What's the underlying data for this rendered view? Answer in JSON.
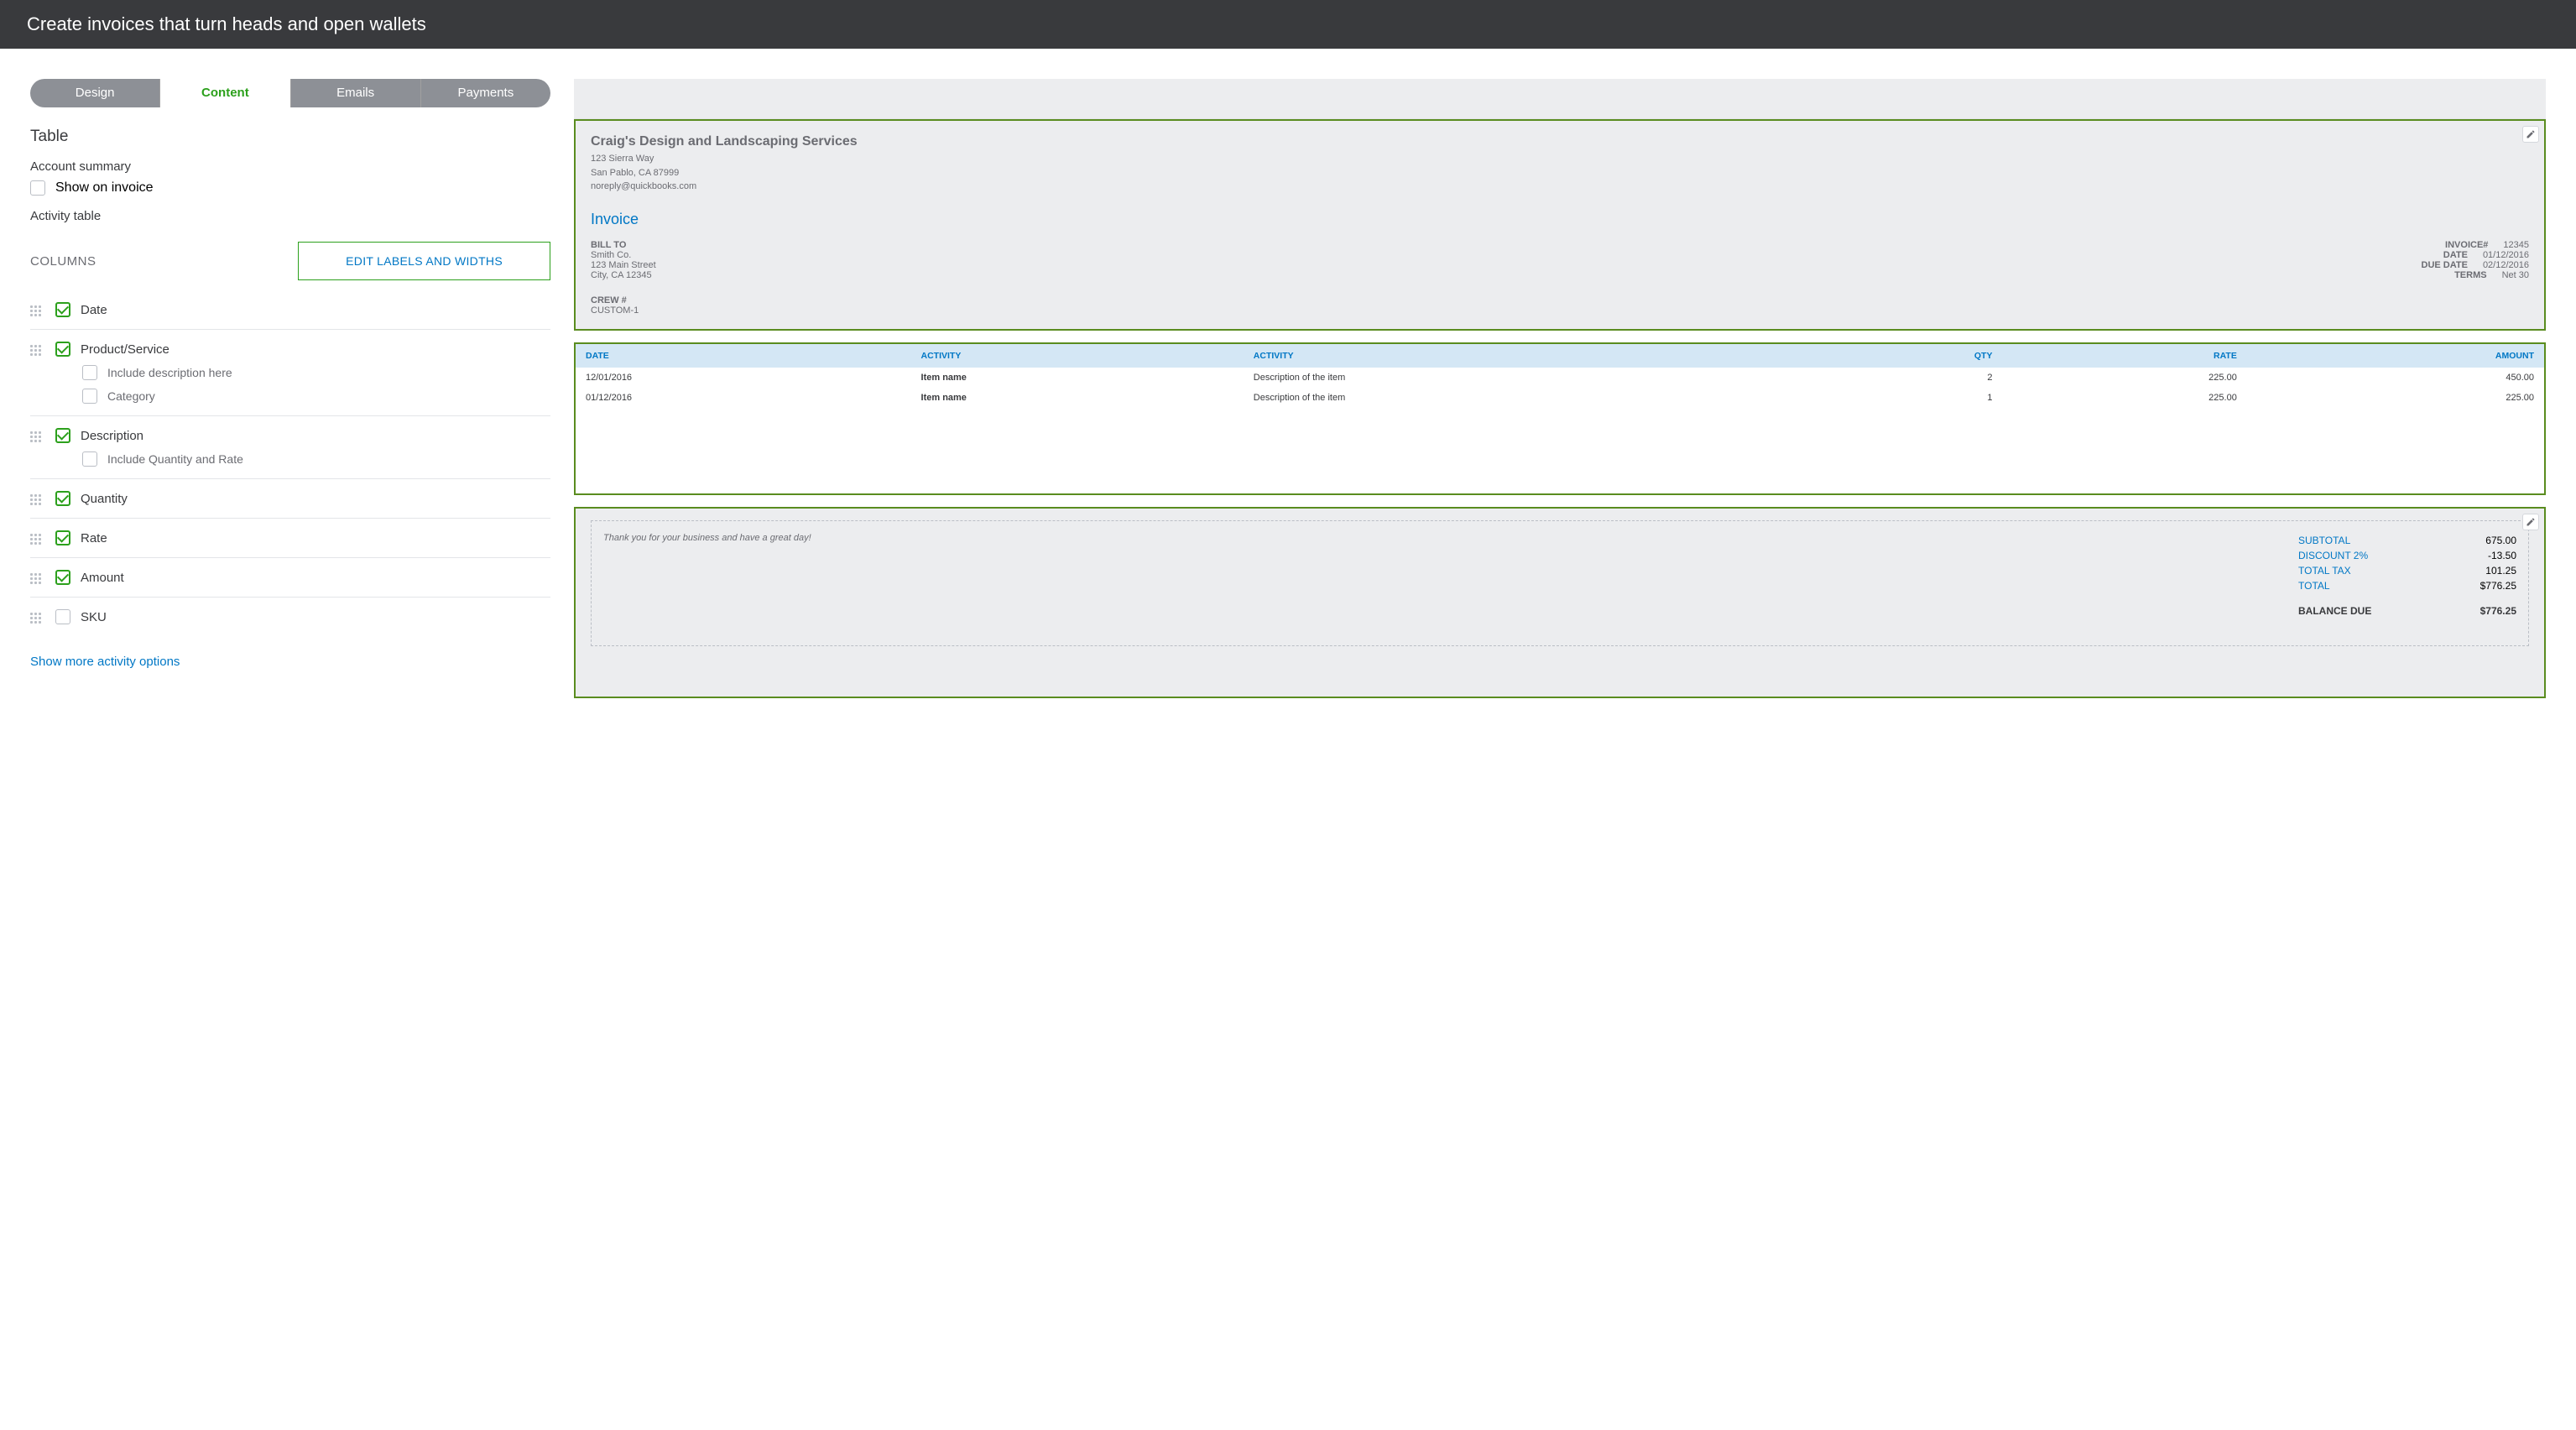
{
  "header": {
    "title": "Create invoices that turn heads and open wallets"
  },
  "tabs": [
    {
      "label": "Design",
      "active": false
    },
    {
      "label": "Content",
      "active": true
    },
    {
      "label": "Emails",
      "active": false
    },
    {
      "label": "Payments",
      "active": false
    }
  ],
  "table_section": {
    "title": "Table",
    "account_summary": "Account summary",
    "show_on_invoice": "Show on invoice",
    "activity_table": "Activity table",
    "columns_label": "COLUMNS",
    "edit_labels_btn": "EDIT LABELS AND WIDTHS",
    "columns": [
      {
        "name": "Date",
        "checked": true,
        "subs": []
      },
      {
        "name": "Product/Service",
        "checked": true,
        "subs": [
          {
            "name": "Include description here",
            "checked": false
          },
          {
            "name": "Category",
            "checked": false
          }
        ]
      },
      {
        "name": "Description",
        "checked": true,
        "subs": [
          {
            "name": "Include Quantity and Rate",
            "checked": false
          }
        ]
      },
      {
        "name": "Quantity",
        "checked": true,
        "subs": []
      },
      {
        "name": "Rate",
        "checked": true,
        "subs": []
      },
      {
        "name": "Amount",
        "checked": true,
        "subs": []
      },
      {
        "name": "SKU",
        "checked": false,
        "subs": []
      }
    ],
    "show_more": "Show more activity options"
  },
  "preview": {
    "company": {
      "name": "Craig's Design and Landscaping Services",
      "line1": "123 Sierra Way",
      "line2": "San Pablo, CA 87999",
      "email": "noreply@quickbooks.com"
    },
    "invoice_title": "Invoice",
    "bill_to": {
      "label": "BILL TO",
      "name": "Smith Co.",
      "line1": "123 Main Street",
      "line2": "City, CA 12345"
    },
    "meta": {
      "invoice_num_label": "INVOICE#",
      "invoice_num": "12345",
      "date_label": "DATE",
      "date": "01/12/2016",
      "due_label": "DUE DATE",
      "due": "02/12/2016",
      "terms_label": "TERMS",
      "terms": "Net 30"
    },
    "crew": {
      "label": "CREW #",
      "value": "CUSTOM-1"
    },
    "table_headers": {
      "date": "DATE",
      "activity1": "ACTIVITY",
      "activity2": "ACTIVITY",
      "qty": "QTY",
      "rate": "RATE",
      "amount": "AMOUNT"
    },
    "rows": [
      {
        "date": "12/01/2016",
        "item": "Item name",
        "desc": "Description of the item",
        "qty": "2",
        "rate": "225.00",
        "amount": "450.00"
      },
      {
        "date": "01/12/2016",
        "item": "Item name",
        "desc": "Description of the item",
        "qty": "1",
        "rate": "225.00",
        "amount": "225.00"
      }
    ],
    "thank_you": "Thank you for your business and have a great day!",
    "totals": {
      "subtotal_label": "SUBTOTAL",
      "subtotal": "675.00",
      "discount_label": "DISCOUNT 2%",
      "discount": "-13.50",
      "tax_label": "TOTAL TAX",
      "tax": "101.25",
      "total_label": "TOTAL",
      "total": "$776.25",
      "balance_label": "BALANCE DUE",
      "balance": "$776.25"
    }
  }
}
